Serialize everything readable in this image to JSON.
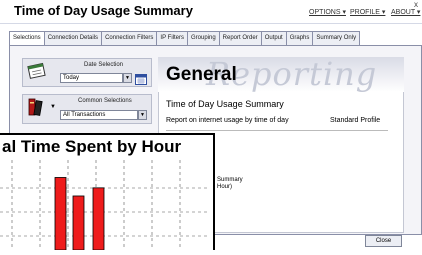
{
  "window": {
    "title": "Time of Day Usage Summary",
    "menu": [
      {
        "label": "OPTIONS ▾"
      },
      {
        "label": "PROFILE ▾"
      },
      {
        "label": "ABOUT ▾"
      }
    ],
    "close_glyph": "x"
  },
  "tabs": [
    {
      "label": "Selections"
    },
    {
      "label": "Connection Details"
    },
    {
      "label": "Connection Filters"
    },
    {
      "label": "IP Filters"
    },
    {
      "label": "Grouping"
    },
    {
      "label": "Report Order"
    },
    {
      "label": "Output"
    },
    {
      "label": "Graphs"
    },
    {
      "label": "Summary Only"
    }
  ],
  "selections": {
    "date": {
      "label": "Date Selection",
      "value": "Today"
    },
    "common": {
      "label": "Common Selections",
      "value": "All Transactions"
    }
  },
  "report": {
    "watermark": "Reporting",
    "heading": "General",
    "title": "Time of Day Usage Summary",
    "description": "Report on internet usage by time of day",
    "profile": "Standard Profile",
    "fragment1": "Summary",
    "fragment2": "Hour)"
  },
  "close_button": {
    "label": "Close"
  },
  "chart_window": {
    "title": "al Time Spent by Hour"
  },
  "chart_data": {
    "type": "bar",
    "title": "al Time Spent by Hour",
    "values": [
      98,
      73,
      84
    ],
    "bar_color": "#ee1c1c",
    "grid": true
  }
}
